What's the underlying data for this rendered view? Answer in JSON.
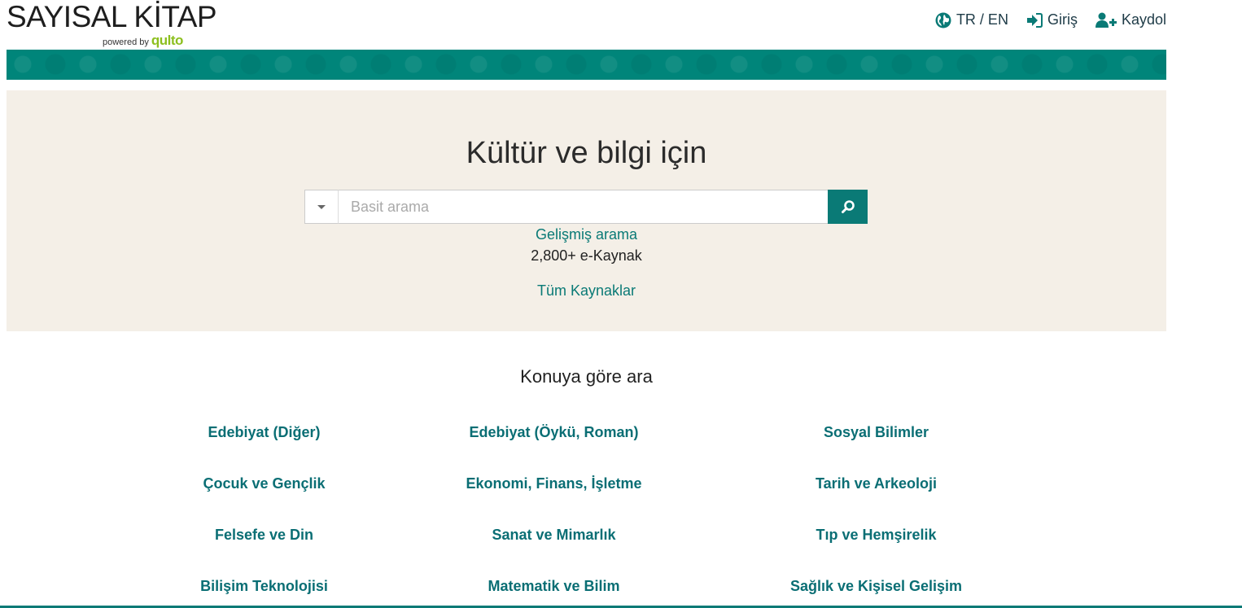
{
  "logo": {
    "title": "SAYISAL KİTAP",
    "powered_by": "powered by",
    "brand": "qulto"
  },
  "nav": {
    "language": "TR / EN",
    "login": "Giriş",
    "register": "Kaydol"
  },
  "hero": {
    "title": "Kültür ve bilgi için",
    "search_placeholder": "Basit arama",
    "advanced_search": "Gelişmiş arama",
    "resource_count": "2,800+ e-Kaynak",
    "all_resources": "Tüm Kaynaklar"
  },
  "subjects": {
    "title": "Konuya göre ara",
    "items": [
      "Edebiyat (Diğer)",
      "Edebiyat (Öykü, Roman)",
      "Sosyal Bilimler",
      "Çocuk ve Gençlik",
      "Ekonomi, Finans, İşletme",
      "Tarih ve Arkeoloji",
      "Felsefe ve Din",
      "Sanat ve Mimarlık",
      "Tıp ve Hemşirelik",
      "Bilişim Teknolojisi",
      "Matematik ve Bilim",
      "Sağlık ve Kişisel Gelişim"
    ]
  },
  "colors": {
    "accent": "#0a7a76",
    "band": "#00857a",
    "hero_bg": "#f4efe7"
  },
  "icons": {
    "language": "globe-icon",
    "login": "sign-in-icon",
    "register": "user-plus-icon",
    "search": "search-icon",
    "dropdown": "caret-down-icon"
  }
}
